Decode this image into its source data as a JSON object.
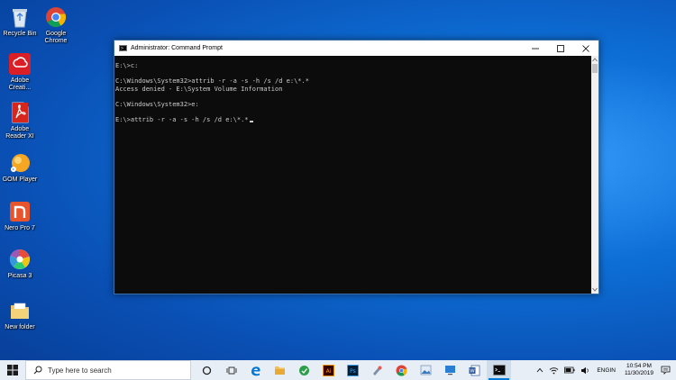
{
  "desktop": {
    "icons": [
      {
        "label": "Recycle Bin"
      },
      {
        "label": "Google Chrome"
      },
      {
        "label": "Adobe Creati..."
      },
      {
        "label": "Adobe Reader XI"
      },
      {
        "label": "GOM Player"
      },
      {
        "label": "Nero Pro 7"
      },
      {
        "label": "Picasa 3"
      },
      {
        "label": "New folder"
      }
    ]
  },
  "window": {
    "title": "Administrator: Command Prompt",
    "console_lines": [
      "E:\\>c:",
      "",
      "C:\\Windows\\System32>attrib -r -a -s -h /s /d e:\\*.*",
      "Access denied - E:\\System Volume Information",
      "",
      "C:\\Windows\\System32>e:",
      "",
      "E:\\>attrib -r -a -s -h /s /d e:\\*.*"
    ]
  },
  "taskbar": {
    "search_placeholder": "Type here to search",
    "lang_top": "ENG",
    "lang_bottom": "IN",
    "time": "10:54 PM",
    "date": "11/30/2019"
  },
  "colors": {
    "accent": "#0078d7",
    "console_bg": "#0c0c0c",
    "console_fg": "#cccccc"
  }
}
